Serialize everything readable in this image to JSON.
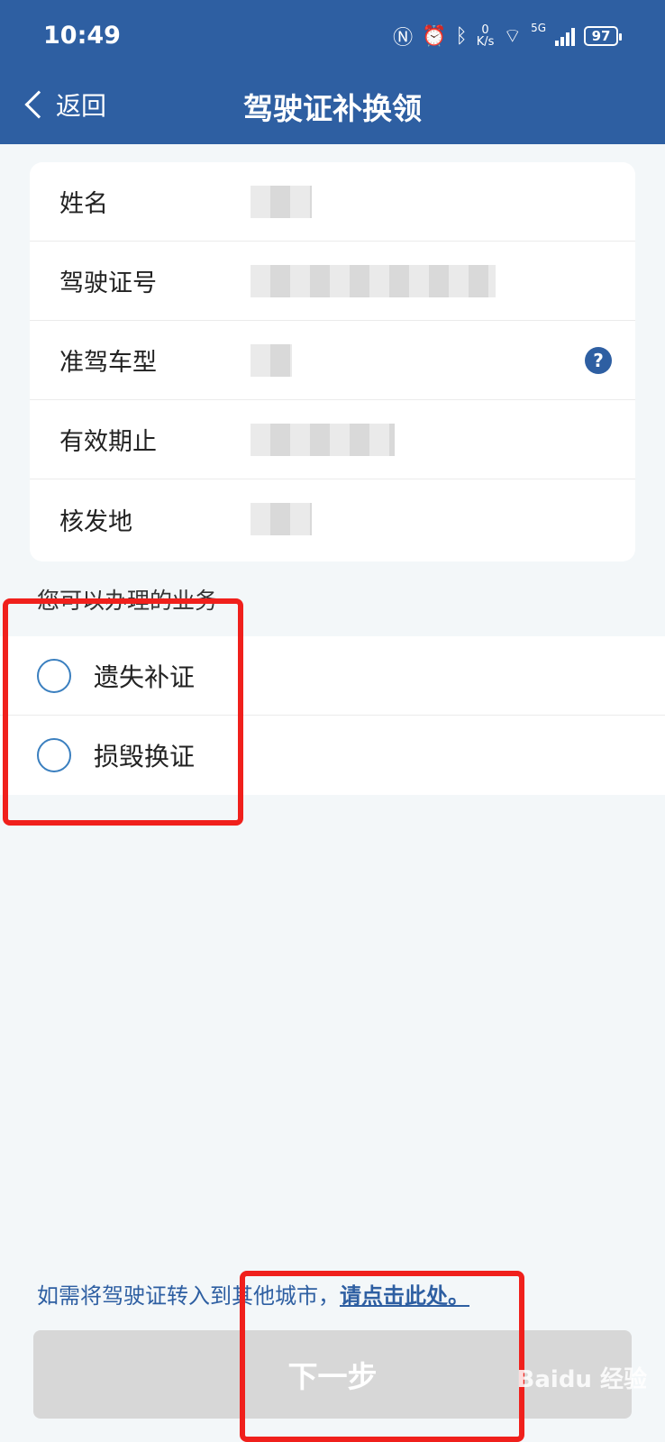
{
  "status_bar": {
    "time": "10:49",
    "speed_value": "0",
    "speed_unit": "K/s",
    "network": "5G",
    "battery": "97"
  },
  "nav": {
    "back_label": "返回",
    "title": "驾驶证补换领"
  },
  "info": {
    "rows": [
      {
        "label": "姓名"
      },
      {
        "label": "驾驶证号"
      },
      {
        "label": "准驾车型",
        "help": "?"
      },
      {
        "label": "有效期止"
      },
      {
        "label": "核发地"
      }
    ]
  },
  "business": {
    "title": "您可以办理的业务",
    "options": [
      {
        "label": "遗失补证",
        "selected": false
      },
      {
        "label": "损毁换证",
        "selected": false
      }
    ]
  },
  "footer": {
    "note_prefix": "如需将驾驶证转入到其他城市，",
    "note_link": "请点击此处。",
    "next_label": "下一步"
  },
  "watermark": "Baidu 经验",
  "colors": {
    "header": "#2e5fa2",
    "accent": "#3a7fbf",
    "highlight": "#f0201c",
    "disabled_button": "#d7d7d7"
  }
}
